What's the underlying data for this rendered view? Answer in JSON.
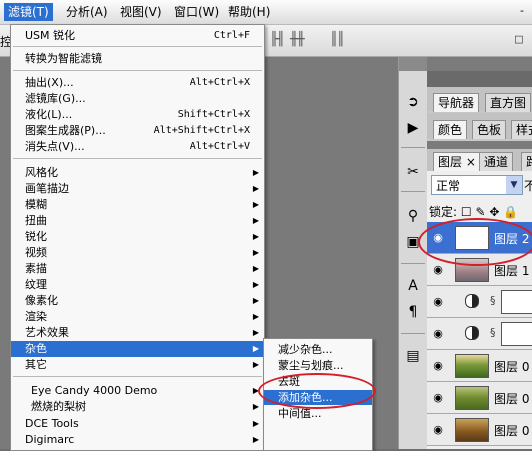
{
  "menubar": {
    "items": [
      {
        "label": "滤镜(T)"
      },
      {
        "label": "分析(A)"
      },
      {
        "label": "视图(V)"
      },
      {
        "label": "窗口(W)"
      },
      {
        "label": "帮助(H)"
      }
    ],
    "minimize_glyph": "-"
  },
  "options": {
    "left_text": "控"
  },
  "filter_menu": {
    "items": [
      {
        "label": "USM 锐化",
        "shortcut": "Ctrl+F",
        "submenu": false
      },
      {
        "label": "转换为智能滤镜",
        "shortcut": "",
        "submenu": false
      },
      {
        "label": "抽出(X)...",
        "shortcut": "Alt+Ctrl+X",
        "submenu": false
      },
      {
        "label": "滤镜库(G)...",
        "shortcut": "",
        "submenu": false
      },
      {
        "label": "液化(L)...",
        "shortcut": "Shift+Ctrl+X",
        "submenu": false
      },
      {
        "label": "图案生成器(P)...",
        "shortcut": "Alt+Shift+Ctrl+X",
        "submenu": false
      },
      {
        "label": "消失点(V)...",
        "shortcut": "Alt+Ctrl+V",
        "submenu": false
      },
      {
        "label": "风格化",
        "shortcut": "",
        "submenu": true
      },
      {
        "label": "画笔描边",
        "shortcut": "",
        "submenu": true
      },
      {
        "label": "模糊",
        "shortcut": "",
        "submenu": true
      },
      {
        "label": "扭曲",
        "shortcut": "",
        "submenu": true
      },
      {
        "label": "锐化",
        "shortcut": "",
        "submenu": true
      },
      {
        "label": "视频",
        "shortcut": "",
        "submenu": true
      },
      {
        "label": "素描",
        "shortcut": "",
        "submenu": true
      },
      {
        "label": "纹理",
        "shortcut": "",
        "submenu": true
      },
      {
        "label": "像素化",
        "shortcut": "",
        "submenu": true
      },
      {
        "label": "渲染",
        "shortcut": "",
        "submenu": true
      },
      {
        "label": "艺术效果",
        "shortcut": "",
        "submenu": true
      },
      {
        "label": "杂色",
        "shortcut": "",
        "submenu": true,
        "highlighted": true
      },
      {
        "label": "其它",
        "shortcut": "",
        "submenu": true
      },
      {
        "label": "Eye Candy 4000 Demo",
        "shortcut": "",
        "submenu": true
      },
      {
        "label": "燃烧的梨树",
        "shortcut": "",
        "submenu": true
      },
      {
        "label": "DCE Tools",
        "shortcut": "",
        "submenu": true
      },
      {
        "label": "Digimarc",
        "shortcut": "",
        "submenu": true
      }
    ]
  },
  "noise_submenu": {
    "items": [
      {
        "label": "减少杂色..."
      },
      {
        "label": "蒙尘与划痕..."
      },
      {
        "label": "去斑"
      },
      {
        "label": "添加杂色...",
        "highlighted": true
      },
      {
        "label": "中间值..."
      }
    ]
  },
  "panels": {
    "row1_tabs": [
      {
        "label": "导航器"
      },
      {
        "label": "直方图"
      }
    ],
    "row2_tabs": [
      {
        "label": "颜色"
      },
      {
        "label": "色板"
      },
      {
        "label": "样式"
      }
    ],
    "layers_tabs": [
      {
        "label": "图层 ×"
      },
      {
        "label": "通道"
      },
      {
        "label": "路径"
      }
    ],
    "blend_mode": "正常",
    "opacity_label": "不",
    "lock_label": "锁定:",
    "layers": [
      {
        "name": "图层 2",
        "selected": true,
        "type": "white"
      },
      {
        "name": "图层 1",
        "selected": false,
        "type": "gradient"
      },
      {
        "name": "",
        "selected": false,
        "type": "adjustment"
      },
      {
        "name": "",
        "selected": false,
        "type": "adjustment"
      },
      {
        "name": "图层 0",
        "selected": false,
        "type": "grass"
      },
      {
        "name": "图层 0",
        "selected": false,
        "type": "grass"
      },
      {
        "name": "图层 0",
        "selected": false,
        "type": "brown"
      }
    ]
  },
  "colors": {
    "highlight": "#2b6fd1",
    "annotation": "#d21f2a"
  }
}
